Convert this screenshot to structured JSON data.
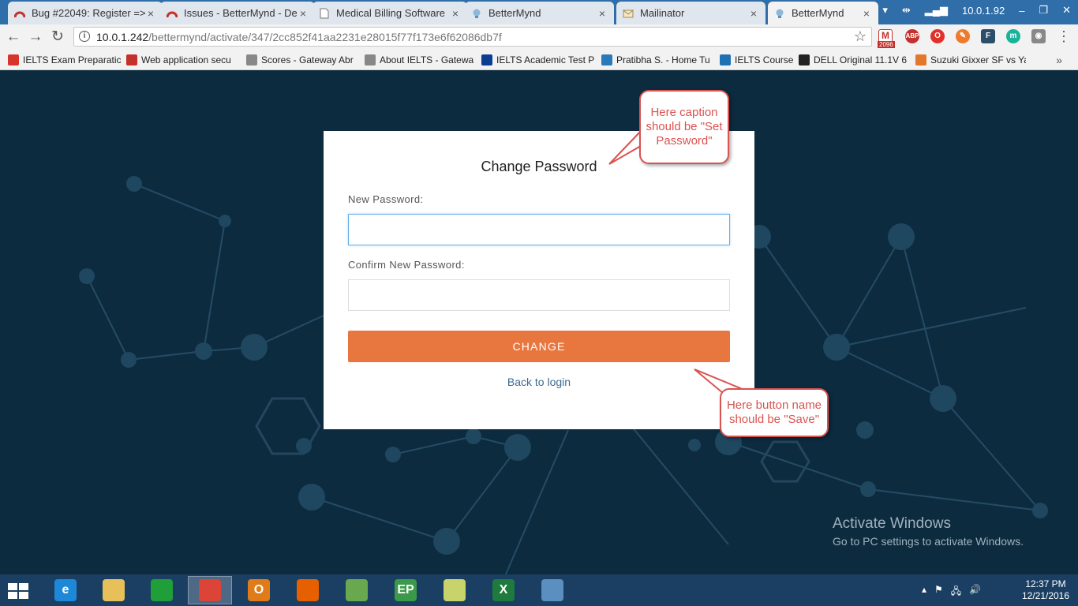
{
  "browser": {
    "tabs": [
      {
        "title": "Bug #22049: Register =>",
        "icon": "redmine-icon"
      },
      {
        "title": "Issues - BetterMynd - De",
        "icon": "redmine-icon"
      },
      {
        "title": "Medical Billing Software",
        "icon": "document-icon"
      },
      {
        "title": "BetterMynd",
        "icon": "bulb-icon"
      },
      {
        "title": "Mailinator",
        "icon": "mail-icon"
      },
      {
        "title": "BetterMynd",
        "icon": "bulb-icon"
      }
    ],
    "tab_close": "×",
    "system_ip": "10.0.1.92",
    "url_host": "10.0.1.242",
    "url_path": "/bettermynd/activate/347/2cc852f41aa2231e28015f77f173e6f62086db7f",
    "extension_badge": "2096"
  },
  "bookmarks": [
    {
      "label": "IELTS Exam Preparatic",
      "color": "#d9342b"
    },
    {
      "label": "Web application secu",
      "color": "#c4302b"
    },
    {
      "label": "Scores - Gateway Abr",
      "color": "#888888"
    },
    {
      "label": "About IELTS - Gatewa",
      "color": "#888888"
    },
    {
      "label": "IELTS Academic Test P",
      "color": "#0b3d91"
    },
    {
      "label": "Pratibha S. - Home Tu",
      "color": "#2a7ab9"
    },
    {
      "label": "IELTS Course",
      "color": "#1f6fb5"
    },
    {
      "label": "DELL Original 11.1V 6",
      "color": "#222222"
    },
    {
      "label": "Suzuki Gixxer SF vs Ya",
      "color": "#e2782b"
    }
  ],
  "form": {
    "title": "Change Password",
    "new_password_label": "New Password:",
    "confirm_password_label": "Confirm New Password:",
    "submit_label": "CHANGE",
    "back_link": "Back to login"
  },
  "annotations": {
    "caption_note": "Here caption should be \"Set Password\"",
    "button_note": "Here button name should be \"Save\""
  },
  "watermark": {
    "title": "Activate Windows",
    "subtitle": "Go to PC settings to activate Windows."
  },
  "taskbar": {
    "apps": [
      {
        "name": "internet-explorer-icon",
        "color": "#1e88d8",
        "glyph": "e",
        "active": false
      },
      {
        "name": "file-explorer-icon",
        "color": "#e8c05a",
        "glyph": "",
        "active": false
      },
      {
        "name": "windows-store-icon",
        "color": "#1f9e3a",
        "glyph": "",
        "active": false
      },
      {
        "name": "chrome-icon",
        "color": "#db4437",
        "glyph": "",
        "active": true
      },
      {
        "name": "outlook-icon",
        "color": "#e07b1a",
        "glyph": "O",
        "active": false
      },
      {
        "name": "firefox-icon",
        "color": "#e66000",
        "glyph": "",
        "active": false
      },
      {
        "name": "notepad-plus-icon",
        "color": "#6aa84f",
        "glyph": "",
        "active": false
      },
      {
        "name": "ep-app-icon",
        "color": "#3a9a4a",
        "glyph": "EP",
        "active": false
      },
      {
        "name": "sticky-notes-icon",
        "color": "#c9d36b",
        "glyph": "",
        "active": false
      },
      {
        "name": "excel-icon",
        "color": "#1f7a3e",
        "glyph": "X",
        "active": false
      },
      {
        "name": "photos-icon",
        "color": "#5a8fc0",
        "glyph": "",
        "active": false
      }
    ],
    "time": "12:37 PM",
    "date": "12/21/2016"
  }
}
